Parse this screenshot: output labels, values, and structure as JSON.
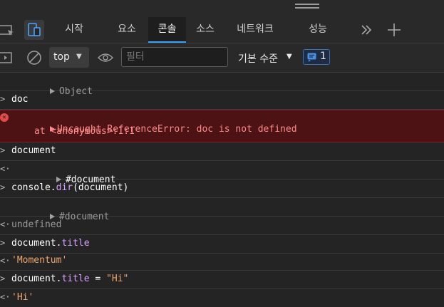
{
  "tabs": [
    {
      "label": "시작"
    },
    {
      "label": "요소"
    },
    {
      "label": "콘솔",
      "active": true
    },
    {
      "label": "소스"
    },
    {
      "label": "네트워크"
    },
    {
      "label": "성능"
    }
  ],
  "toolbar": {
    "context_label": "top",
    "filter_placeholder": "필터",
    "level_label": "기본 수준",
    "message_count": "1"
  },
  "console": {
    "r0_text": "Object",
    "r1_text": "doc",
    "err_line1": "Uncaught ReferenceError: doc is not defined",
    "err_line2": "at <anonymous>:1:1",
    "r3_text": "document",
    "r4_text": "#document",
    "r5_a": "console.",
    "r5_b": "dir",
    "r5_c": "(document)",
    "r6_text": "#document",
    "r7_text": "undefined",
    "r8_a": "document.",
    "r8_b": "title",
    "r9_text": "'Momentum'",
    "r10_a": "document.",
    "r10_b": "title",
    "r10_c": " = ",
    "r10_d": "\"Hi\"",
    "r11_text": "'Hi'"
  },
  "colors": {
    "accent": "#3aa0ff",
    "error_bg": "#4d1214",
    "error_text": "#ff8a8a",
    "string": "#f0a46d",
    "property": "#d9a0ff"
  }
}
